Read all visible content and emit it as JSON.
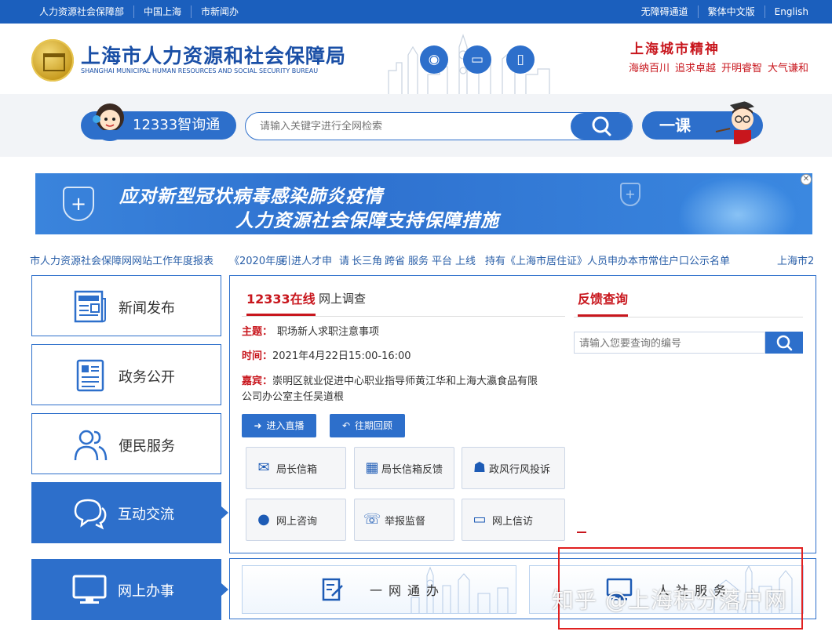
{
  "topbar": {
    "left_links": [
      "人力资源社会保障部",
      "中国上海",
      "市新闻办"
    ],
    "right_links": [
      "无障碍通道",
      "繁体中文版",
      "English"
    ]
  },
  "header": {
    "title_cn": "上海市人力资源和社会保障局",
    "title_en": "SHANGHAI MUNICIPAL HUMAN RESOURCES AND SOCIAL SECURITY BUREAU",
    "spirit_title": "上海城市精神",
    "spirit_items": [
      "海纳百川",
      "追求卓越",
      "开明睿智",
      "大气谦和"
    ]
  },
  "search": {
    "left_pill": "12333智询通",
    "placeholder": "请输入关键字进行全网检索",
    "right_pill": "一课"
  },
  "banner": {
    "line1": "应对新型冠状病毒感染肺炎疫情",
    "line2": "人力资源社会保障支持保障措施"
  },
  "marquee": [
    "市人力资源社会保障网网站工作年度报表",
    "《2020年度",
    "引进人才申",
    "请",
    "长三角",
    "跨省",
    "服务",
    "平台",
    "上线",
    "持有《上海市居住证》人员申办本市常住户口公示名单",
    "上海市2"
  ],
  "nav": [
    {
      "label": "新闻发布",
      "icon": "news-icon"
    },
    {
      "label": "政务公开",
      "icon": "document-icon"
    },
    {
      "label": "便民服务",
      "icon": "people-icon"
    },
    {
      "label": "互动交流",
      "icon": "chat-icon"
    },
    {
      "label": "网上办事",
      "icon": "monitor-icon"
    }
  ],
  "online": {
    "tab_active": "12333在线",
    "tab_other": "网上调查",
    "topic_label": "主题：",
    "topic": "职场新人求职注意事项",
    "time_label": "时间：",
    "time": "2021年4月22日15:00-16:00",
    "guest_label": "嘉宾：",
    "guest_line1": "崇明区就业促进中心职业指导师黄江华和上海大瀛食品有限",
    "guest_line2": "公司办公室主任吴道根",
    "live_button": "进入直播",
    "review_button": "往期回顾"
  },
  "grid": [
    {
      "label": "局长信箱",
      "icon": "mail-icon"
    },
    {
      "label": "局长信箱反馈",
      "icon": "inbox-icon"
    },
    {
      "label": "政风行风投诉",
      "icon": "complaint-icon"
    },
    {
      "label": "网上咨询",
      "icon": "consult-icon"
    },
    {
      "label": "举报监督",
      "icon": "phone-icon"
    },
    {
      "label": "网上信访",
      "icon": "monitor-icon"
    }
  ],
  "feedback": {
    "tab": "反馈查询",
    "placeholder": "请输入您要查询的编号"
  },
  "services": {
    "left": "一网通办",
    "right": "人社服务"
  },
  "watermark": "知乎 @上海积分落户网",
  "colors": {
    "primary": "#2d6fcb",
    "topbar": "#1b5fbd",
    "accent_red": "#c8161d"
  }
}
